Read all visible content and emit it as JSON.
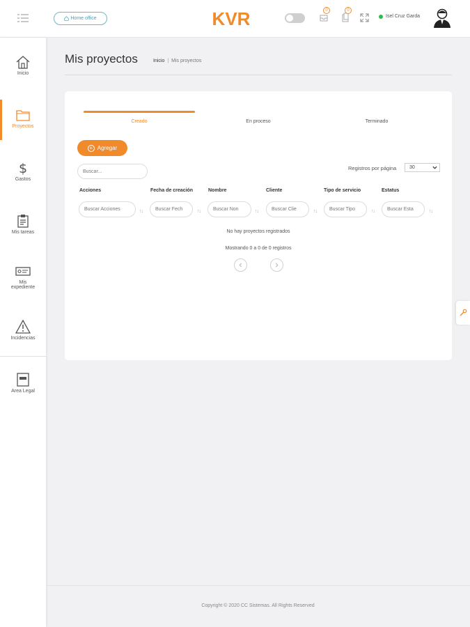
{
  "topbar": {
    "home_office_label": "Home office",
    "logo_text": "KVR",
    "notifications": [
      {
        "name": "messages",
        "count": "0"
      },
      {
        "name": "documents",
        "count": "0"
      }
    ],
    "user_name": "Isel Cruz Garda",
    "status_color": "#2dbb4e"
  },
  "brand": {
    "accent": "#f08a2b"
  },
  "sidebar": {
    "items": [
      {
        "label": "Inicio",
        "icon": "home-icon"
      },
      {
        "label": "Proyectos",
        "icon": "folder-icon"
      },
      {
        "label": "Gastos",
        "icon": "dollar-icon"
      },
      {
        "label": "Mis tareas",
        "icon": "clipboard-icon"
      },
      {
        "label": "Mis expediente",
        "icon": "id-card-icon"
      },
      {
        "label": "Incidencias",
        "icon": "warning-icon"
      },
      {
        "label": "Area Legal",
        "icon": "legal-document-icon"
      }
    ]
  },
  "page": {
    "title": "Mis proyectos",
    "breadcrumb_home": "Inicio",
    "breadcrumb_separator": "|",
    "breadcrumb_current": "Mis proyectos"
  },
  "tabs": [
    {
      "label": "Creado",
      "active": true
    },
    {
      "label": "En proceso",
      "active": false
    },
    {
      "label": "Terminado",
      "active": false
    }
  ],
  "table": {
    "add_label": "Agregar",
    "search_placeholder": "Buscar...",
    "per_page_label": "Registros por página",
    "per_page_value": "30",
    "columns": [
      {
        "header": "Acciones",
        "filter": "Buscar Acciones"
      },
      {
        "header": "Fecha de creación",
        "filter": "Buscar Fech"
      },
      {
        "header": "Nombre",
        "filter": "Buscar Non"
      },
      {
        "header": "Cliente",
        "filter": "Buscar Clie"
      },
      {
        "header": "Tipo de servicio",
        "filter": "Buscar Tipo"
      },
      {
        "header": "Estatus",
        "filter": "Buscar Esta"
      }
    ],
    "empty_message": "No hay proyectos registrados",
    "showing": "Mostrando 0 a 0 de 0 registros"
  },
  "footer": {
    "copyright": "Copyright © 2020 CC Sistemas. All Rights Reserved"
  }
}
